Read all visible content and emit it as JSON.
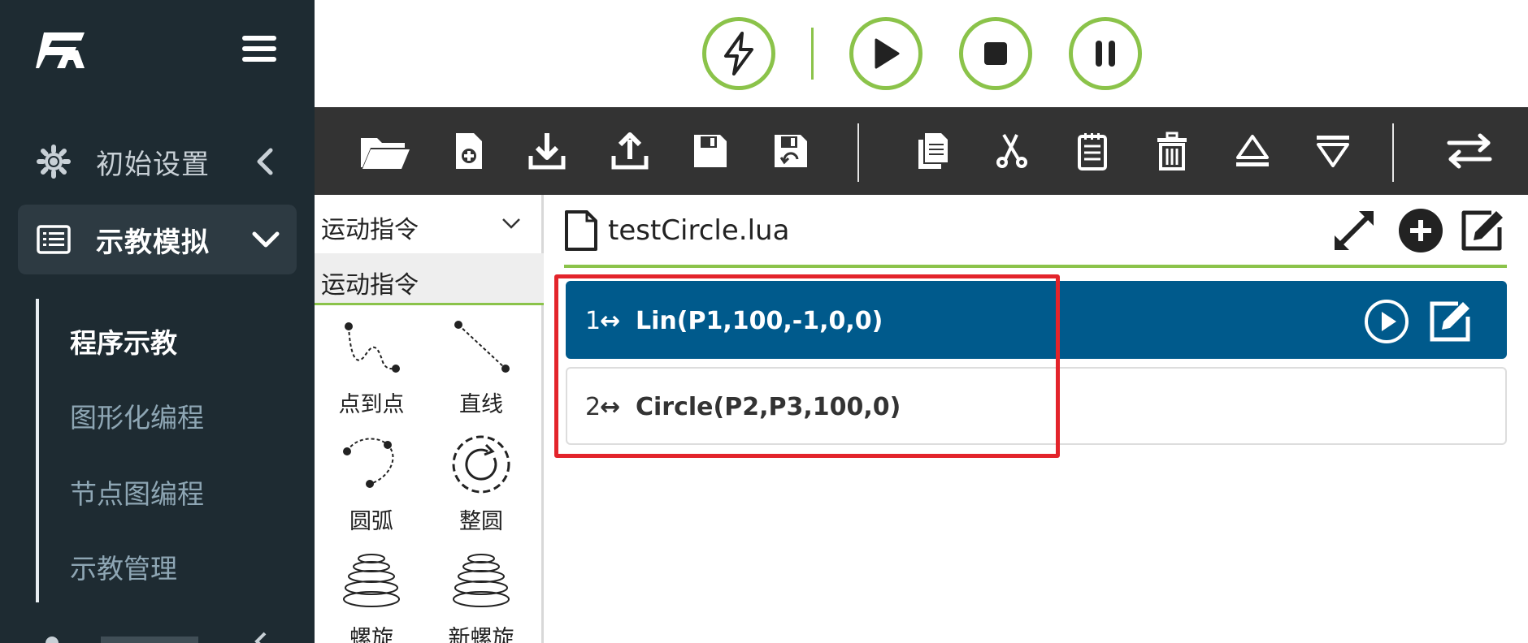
{
  "sidebar": {
    "settings_label": "初始设置",
    "teach_label": "示教模拟",
    "submenu": [
      {
        "label": "程序示教",
        "active": true
      },
      {
        "label": "图形化编程",
        "active": false
      },
      {
        "label": "节点图编程",
        "active": false
      },
      {
        "label": "示教管理",
        "active": false
      }
    ]
  },
  "run_controls": [
    "lightning-icon",
    "play-icon",
    "stop-icon",
    "pause-icon"
  ],
  "toolbar": {
    "file_group": [
      "open-folder-icon",
      "new-file-icon",
      "import-icon",
      "export-icon",
      "save-icon",
      "save-as-icon"
    ],
    "edit_group": [
      "copy-icon",
      "cut-icon",
      "paste-icon",
      "delete-icon",
      "move-up-icon",
      "move-down-icon"
    ],
    "switch": "swap-icon"
  },
  "palette": {
    "selected_category": "运动指令",
    "category_header": "运动指令",
    "items": [
      {
        "label": "点到点",
        "icon": "ptp-icon"
      },
      {
        "label": "直线",
        "icon": "line-icon"
      },
      {
        "label": "圆弧",
        "icon": "arc-icon"
      },
      {
        "label": "整圆",
        "icon": "circle-icon"
      },
      {
        "label": "螺旋",
        "icon": "spiral-icon"
      },
      {
        "label": "新螺旋",
        "icon": "new-spiral-icon"
      }
    ]
  },
  "editor": {
    "filename": "testCircle.lua",
    "rows": [
      {
        "num": "1",
        "arrow": "↔",
        "cmd": "Lin(P1,100,-1,0,0)",
        "selected": true
      },
      {
        "num": "2",
        "arrow": "↔",
        "cmd": "Circle(P2,P3,100,0)",
        "selected": false
      }
    ]
  },
  "colors": {
    "sidebar_bg": "#1e2b32",
    "accent_green": "#8bc34a",
    "toolbar_bg": "#333333",
    "selected_row": "#005a8c",
    "highlight_red": "#e3242b"
  }
}
